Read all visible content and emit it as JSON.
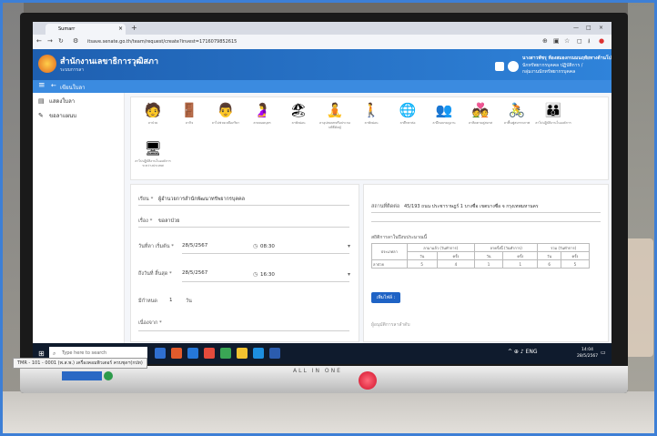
{
  "browser": {
    "tab_title": "Sumarr",
    "url": "itsave.senate.go.th/team/request/create?invest=1716079852615",
    "controls": [
      "—",
      "□",
      "×"
    ]
  },
  "app": {
    "org_name": "สำนักงานเลขาธิการวุฒิสภา",
    "org_sub": "ระบบการลา",
    "user_name": "นางสาวพัชรุ ห้องสมองกรมมนฤทัยทางด้านโป",
    "user_role1": "นักทรัพยากรบุคคล ปฏิบัติการ /",
    "user_role2": "กลุ่มงานนักทรัพยากรบุคคล",
    "page_crumb": "เขียนใบลา"
  },
  "sidebar": {
    "items": [
      {
        "label": "แสดงใบลา",
        "icon": "document-icon"
      },
      {
        "label": "ขอลาแผนบ",
        "icon": "edit-icon"
      }
    ]
  },
  "leave_types": [
    {
      "label": "ลาป่วย",
      "glyph": "🧑"
    },
    {
      "label": "ลากิจ",
      "glyph": "🚪"
    },
    {
      "label": "ลาไปช่วยเหลือภริยา",
      "glyph": "👨"
    },
    {
      "label": "ลาคลอดบุตร",
      "glyph": "🤰"
    },
    {
      "label": "ลาพักผ่อน",
      "glyph": "🏖"
    },
    {
      "label": "ลาอุปสมบทหรือประกอบพิธีฮัจญ์",
      "glyph": "🧘"
    },
    {
      "label": "ลาพักผ่อน",
      "glyph": "🚶"
    },
    {
      "label": "ลาศึกษาต่อ",
      "glyph": "🌐"
    },
    {
      "label": "ลาฝึกอบรมดูงาน",
      "glyph": "👥"
    },
    {
      "label": "ลาติดตามคู่สมรส",
      "glyph": "💑"
    },
    {
      "label": "ลาฟื้นฟูสมรรถภาพ",
      "glyph": "🚴"
    },
    {
      "label": "ลาไปปฏิบัติงานในองค์การ",
      "glyph": "👪"
    },
    {
      "label": "ลาไปปฏิบัติงานในองค์การระหว่างประเทศ",
      "glyph": "🖥"
    }
  ],
  "form": {
    "to_label": "เรียน *",
    "to_value": "ผู้อำนวยการสำนักพัฒนาทรัพยากรบุคคล",
    "subject_label": "เรื่อง *",
    "subject_value": "ขอลาป่วย",
    "start_label": "วันที่ลา เริ่มต้น *",
    "start_date": "28/5/2567",
    "start_time": "08:30",
    "end_label": "ถึงวันที่ สิ้นสุด *",
    "end_date": "28/5/2567",
    "end_time": "16:30",
    "total_label": "มีกำหนด",
    "total_value": "1",
    "total_unit": "วัน",
    "reason_label": "เนื่องจาก *"
  },
  "right": {
    "address_label": "สถานที่ติดต่อ",
    "address_value": "45/193 ถนน ประชาราษฎร์ 1 บางซื่อ เขตบางซื่อ จ กรุงเทพมหานคร",
    "stats_title": "สถิติการลาในปีงบประมาณนี้",
    "table_header": [
      "ประเภทลา",
      "ลามาแล้ว (วันทำการ)",
      "ลาครั้งนี้ (วันทำการ)",
      "รวม (วันทำการ)"
    ],
    "table_sub": [
      "วัน",
      "ครั้ง",
      "วัน",
      "ครั้ง",
      "วัน",
      "ครั้ง"
    ],
    "table_row": [
      "ลาป่วย",
      "5",
      "4",
      "1",
      "1",
      "6",
      "5"
    ],
    "add_button": "เพิ่มไฟล์ :",
    "approver_label": "ผู้อนุมัติการลาลำดับ"
  },
  "taskbar": {
    "search_placeholder": "Type here to search",
    "time": "14:04",
    "date": "28/5/2567",
    "tray": "^ ⊕ ♪ ENG"
  },
  "monitor": {
    "brand": "ALL IN ONE",
    "sticker": "TMR - 101 - 0001 (พ.ส.พ.) เครื่องคอมพิวเตอร์ ครบชุดฯ(กปท)"
  }
}
